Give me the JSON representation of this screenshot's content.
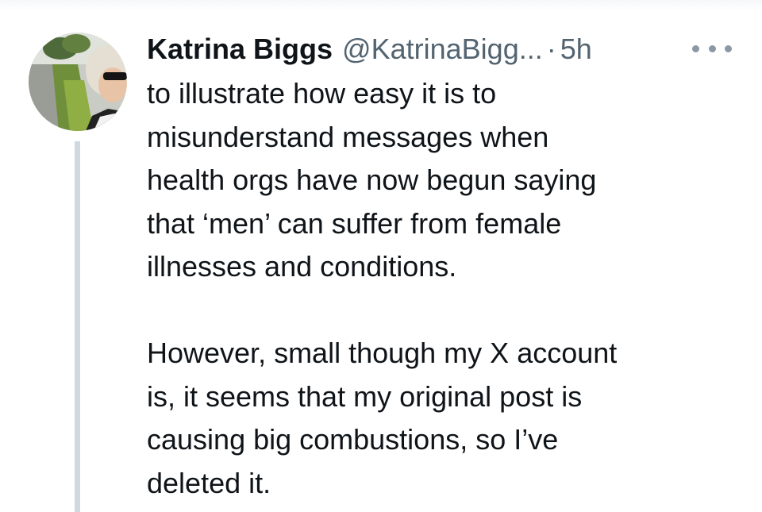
{
  "tweet": {
    "author_name": "Katrina Biggs",
    "handle": "@KatrinaBigg...",
    "separator": "·",
    "time": "5h",
    "more_icon": "ellipsis-icon",
    "avatar_icon": "profile-photo",
    "paragraph_1_lines": [
      "to illustrate how easy it is to",
      "misunderstand messages when",
      "health orgs have now begun saying",
      "that ‘men’ can suffer from female",
      "illnesses and conditions."
    ],
    "paragraph_2_lines": [
      "However, small though my X account",
      "is, it seems that my original post is",
      "causing big combustions, so I’ve",
      "deleted it."
    ]
  },
  "colors": {
    "text": "#0f1419",
    "secondary_text": "#536471",
    "thread_line": "#cfd9de",
    "more_dots": "#8b98a5"
  }
}
